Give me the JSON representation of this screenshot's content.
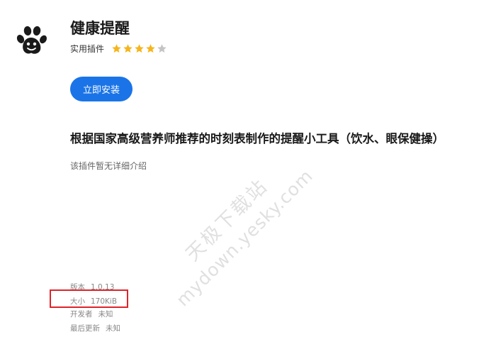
{
  "app": {
    "name": "健康提醒",
    "category": "实用插件",
    "rating": 4,
    "rating_max": 5,
    "install_label": "立即安装"
  },
  "headline": "根据国家高级营养师推荐的时刻表制作的提醒小工具（饮水、眼保健操）",
  "description": "该插件暂无详细介绍",
  "info": {
    "version_label": "版本",
    "version": "1.0.13",
    "size_label": "大小",
    "size": "170KiB",
    "developer_label": "开发者",
    "developer": "未知",
    "updated_label": "最后更新",
    "updated": "未知"
  },
  "watermark": {
    "line1": "天极下载站",
    "line2": "mydown.yesky.com"
  },
  "colors": {
    "accent": "#1a74e8",
    "star_filled": "#f5b51c",
    "star_empty": "#c4c4c4",
    "highlight": "#e0222a"
  },
  "icons": {
    "app_icon": "paw-print-icon",
    "star": "star-icon"
  }
}
